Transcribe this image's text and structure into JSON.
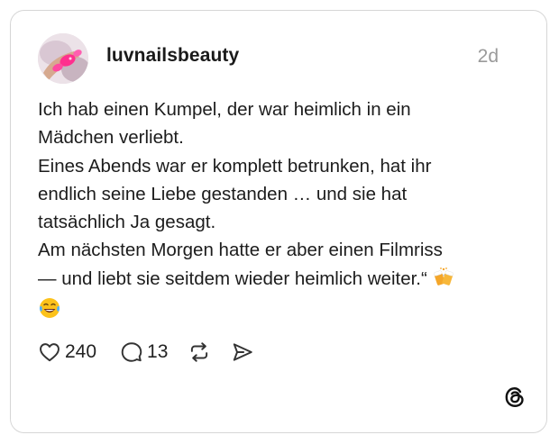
{
  "post": {
    "username": "luvnailsbeauty",
    "timestamp": "2d",
    "lines": [
      "Ich hab einen Kumpel, der war heimlich in ein",
      "Mädchen verliebt.",
      "Eines Abends war er komplett betrunken, hat ihr",
      "endlich seine Liebe gestanden … und sie hat",
      "tatsächlich Ja gesagt.",
      "Am nächsten Morgen hatte er aber einen Filmriss",
      "— und liebt sie seitdem wieder heimlich weiter.“"
    ],
    "emojis": [
      "clinking-beer-mugs",
      "face-with-tears-of-joy"
    ]
  },
  "actions": {
    "likes": "240",
    "replies": "13"
  },
  "icons": {
    "like": "heart-icon",
    "reply": "speech-bubble-icon",
    "repost": "repost-icon",
    "share": "send-icon",
    "logo": "threads-logo-icon"
  }
}
